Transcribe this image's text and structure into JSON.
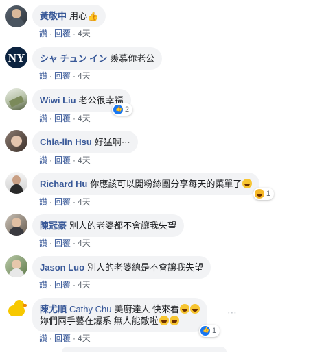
{
  "comments": [
    {
      "author": "黃敬中",
      "text": "用心",
      "suffix_icon": "thumbs-up-icon",
      "actions": {
        "like": "讚",
        "reply": "回覆",
        "time": "4天"
      }
    },
    {
      "author": "シャ チュン イン",
      "text": "羨慕你老公",
      "actions": {
        "like": "讚",
        "reply": "回覆",
        "time": "4天"
      }
    },
    {
      "author": "Wiwi Liu",
      "text": "老公很幸福",
      "reaction_count": "2",
      "actions": {
        "like": "讚",
        "reply": "回覆",
        "time": "4天"
      }
    },
    {
      "author": "Chia-lin Hsu",
      "text": "好猛啊⋯",
      "actions": {
        "like": "讚",
        "reply": "回覆",
        "time": "4天"
      }
    },
    {
      "author": "Richard Hu",
      "text": "你應該可以開粉絲團分享每天的菜單了",
      "reaction_count": "1",
      "actions": {
        "like": "讚",
        "reply": "回覆",
        "time": "4天"
      }
    },
    {
      "author": "陳冠豪",
      "text": "別人的老婆都不會讓我失望",
      "actions": {
        "like": "讚",
        "reply": "回覆",
        "time": "4天"
      }
    },
    {
      "author": "Jason Luo",
      "text": "別人的老婆總是不會讓我失望",
      "actions": {
        "like": "讚",
        "reply": "回覆",
        "time": "4天"
      }
    },
    {
      "author": "陳尤順",
      "tag": "Cathy Chu",
      "text": "美廚達人 快來看",
      "text2": "妳們兩手藝在爆系 無人能敵啦",
      "reaction_count": "1",
      "actions": {
        "like": "讚",
        "reply": "回覆",
        "time": "4天"
      }
    }
  ],
  "colors": {
    "link": "#385898",
    "bubble": "#f2f3f5",
    "meta": "#606770",
    "like": "#1877f2",
    "haha": "#f7b928"
  }
}
